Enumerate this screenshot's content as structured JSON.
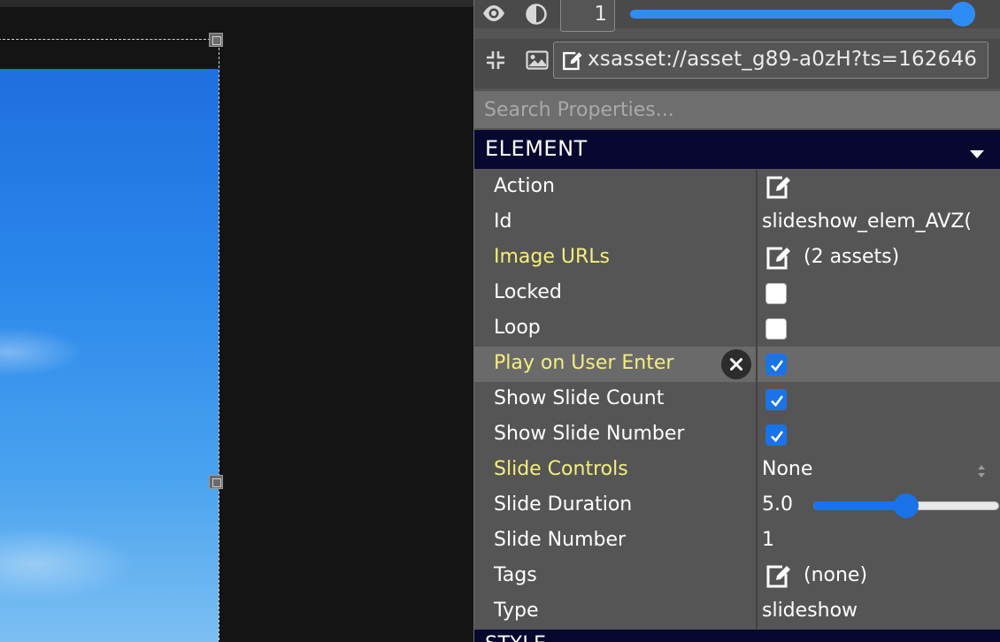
{
  "toolbar": {
    "opacity_value": "1",
    "opacity_level": 1.0,
    "icons": [
      "eye-icon",
      "contrast-icon",
      "shrink-icon",
      "image-icon",
      "edit-icon"
    ]
  },
  "asset_url": "xsasset://asset_g89-a0zH?ts=162646",
  "search": {
    "placeholder": "Search Properties..."
  },
  "section": {
    "title": "ELEMENT",
    "collapse_icon": "chevron-down-icon"
  },
  "properties": {
    "action": {
      "label": "Action"
    },
    "id": {
      "label": "Id",
      "value": "slideshow_elem_AVZ("
    },
    "image_urls": {
      "label": "Image URLs",
      "value": "(2 assets)"
    },
    "locked": {
      "label": "Locked",
      "checked": false
    },
    "loop": {
      "label": "Loop",
      "checked": false
    },
    "play_on_user_enter": {
      "label": "Play on User Enter",
      "checked": true
    },
    "show_slide_count": {
      "label": "Show Slide Count",
      "checked": true
    },
    "show_slide_number": {
      "label": "Show Slide Number",
      "checked": true
    },
    "slide_controls": {
      "label": "Slide Controls",
      "value": "None"
    },
    "slide_duration": {
      "label": "Slide Duration",
      "value": "5.0",
      "slider_fraction": 0.5
    },
    "slide_number": {
      "label": "Slide Number",
      "value": "1"
    },
    "tags": {
      "label": "Tags",
      "value": "(none)"
    },
    "type": {
      "label": "Type",
      "value": "slideshow"
    }
  },
  "next_section": {
    "title": "STYLE"
  },
  "colors": {
    "accent": "#2e8cf7",
    "checkbox_checked": "#1a73e8",
    "section_header_bg": "#07072f",
    "highlighted_label": "#f4ef7a",
    "panel_bg": "#555555"
  }
}
